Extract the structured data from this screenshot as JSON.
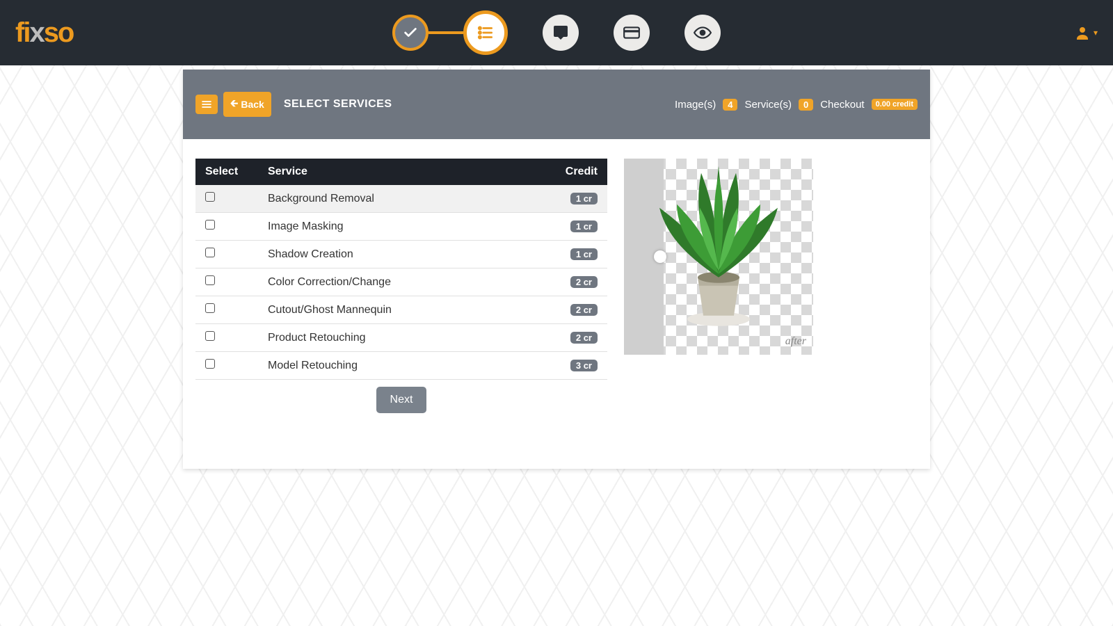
{
  "brand": "fixso",
  "steps": [
    {
      "icon": "check-icon",
      "state": "done"
    },
    {
      "icon": "list-icon",
      "state": "active"
    },
    {
      "icon": "chat-icon",
      "state": "future"
    },
    {
      "icon": "card-icon",
      "state": "future"
    },
    {
      "icon": "eye-icon",
      "state": "future"
    }
  ],
  "header": {
    "back_label": "Back",
    "title": "SELECT SERVICES",
    "images_label": "Image(s)",
    "images_count": "4",
    "services_label": "Service(s)",
    "services_count": "0",
    "checkout_label": "Checkout",
    "checkout_value": "0.00 credit"
  },
  "table": {
    "cols": {
      "select": "Select",
      "service": "Service",
      "credit": "Credit"
    },
    "rows": [
      {
        "service": "Background Removal",
        "credit": "1 cr"
      },
      {
        "service": "Image Masking",
        "credit": "1 cr"
      },
      {
        "service": "Shadow Creation",
        "credit": "1 cr"
      },
      {
        "service": "Color Correction/Change",
        "credit": "2 cr"
      },
      {
        "service": "Cutout/Ghost Mannequin",
        "credit": "2 cr"
      },
      {
        "service": "Product Retouching",
        "credit": "2 cr"
      },
      {
        "service": "Model Retouching",
        "credit": "3 cr"
      }
    ]
  },
  "preview": {
    "after_label": "after"
  },
  "next_label": "Next"
}
